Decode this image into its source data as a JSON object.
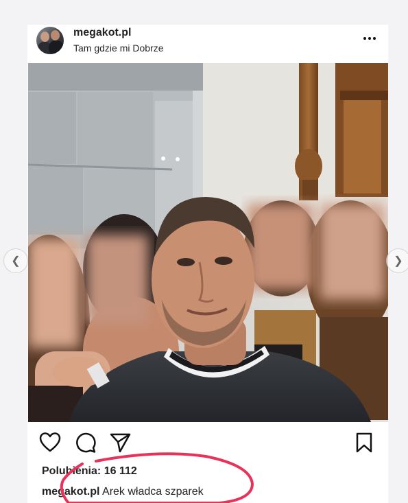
{
  "post": {
    "username": "megakot.pl",
    "location": "Tam gdzie mi Dobrze",
    "likes_label": "Polubienia:",
    "likes_count": "16 112",
    "caption_username": "megakot.pl",
    "caption_text": "Arek władca szparek"
  },
  "icons": {
    "more": "more-options-icon",
    "like": "heart-icon",
    "comment": "comment-bubble-icon",
    "share": "paper-plane-icon",
    "save": "bookmark-icon",
    "prev": "chevron-left-icon",
    "next": "chevron-right-icon"
  },
  "colors": {
    "annotation_circle": "#e8325a",
    "background": "#f3f3f5",
    "card": "#ffffff",
    "text": "#222222"
  }
}
